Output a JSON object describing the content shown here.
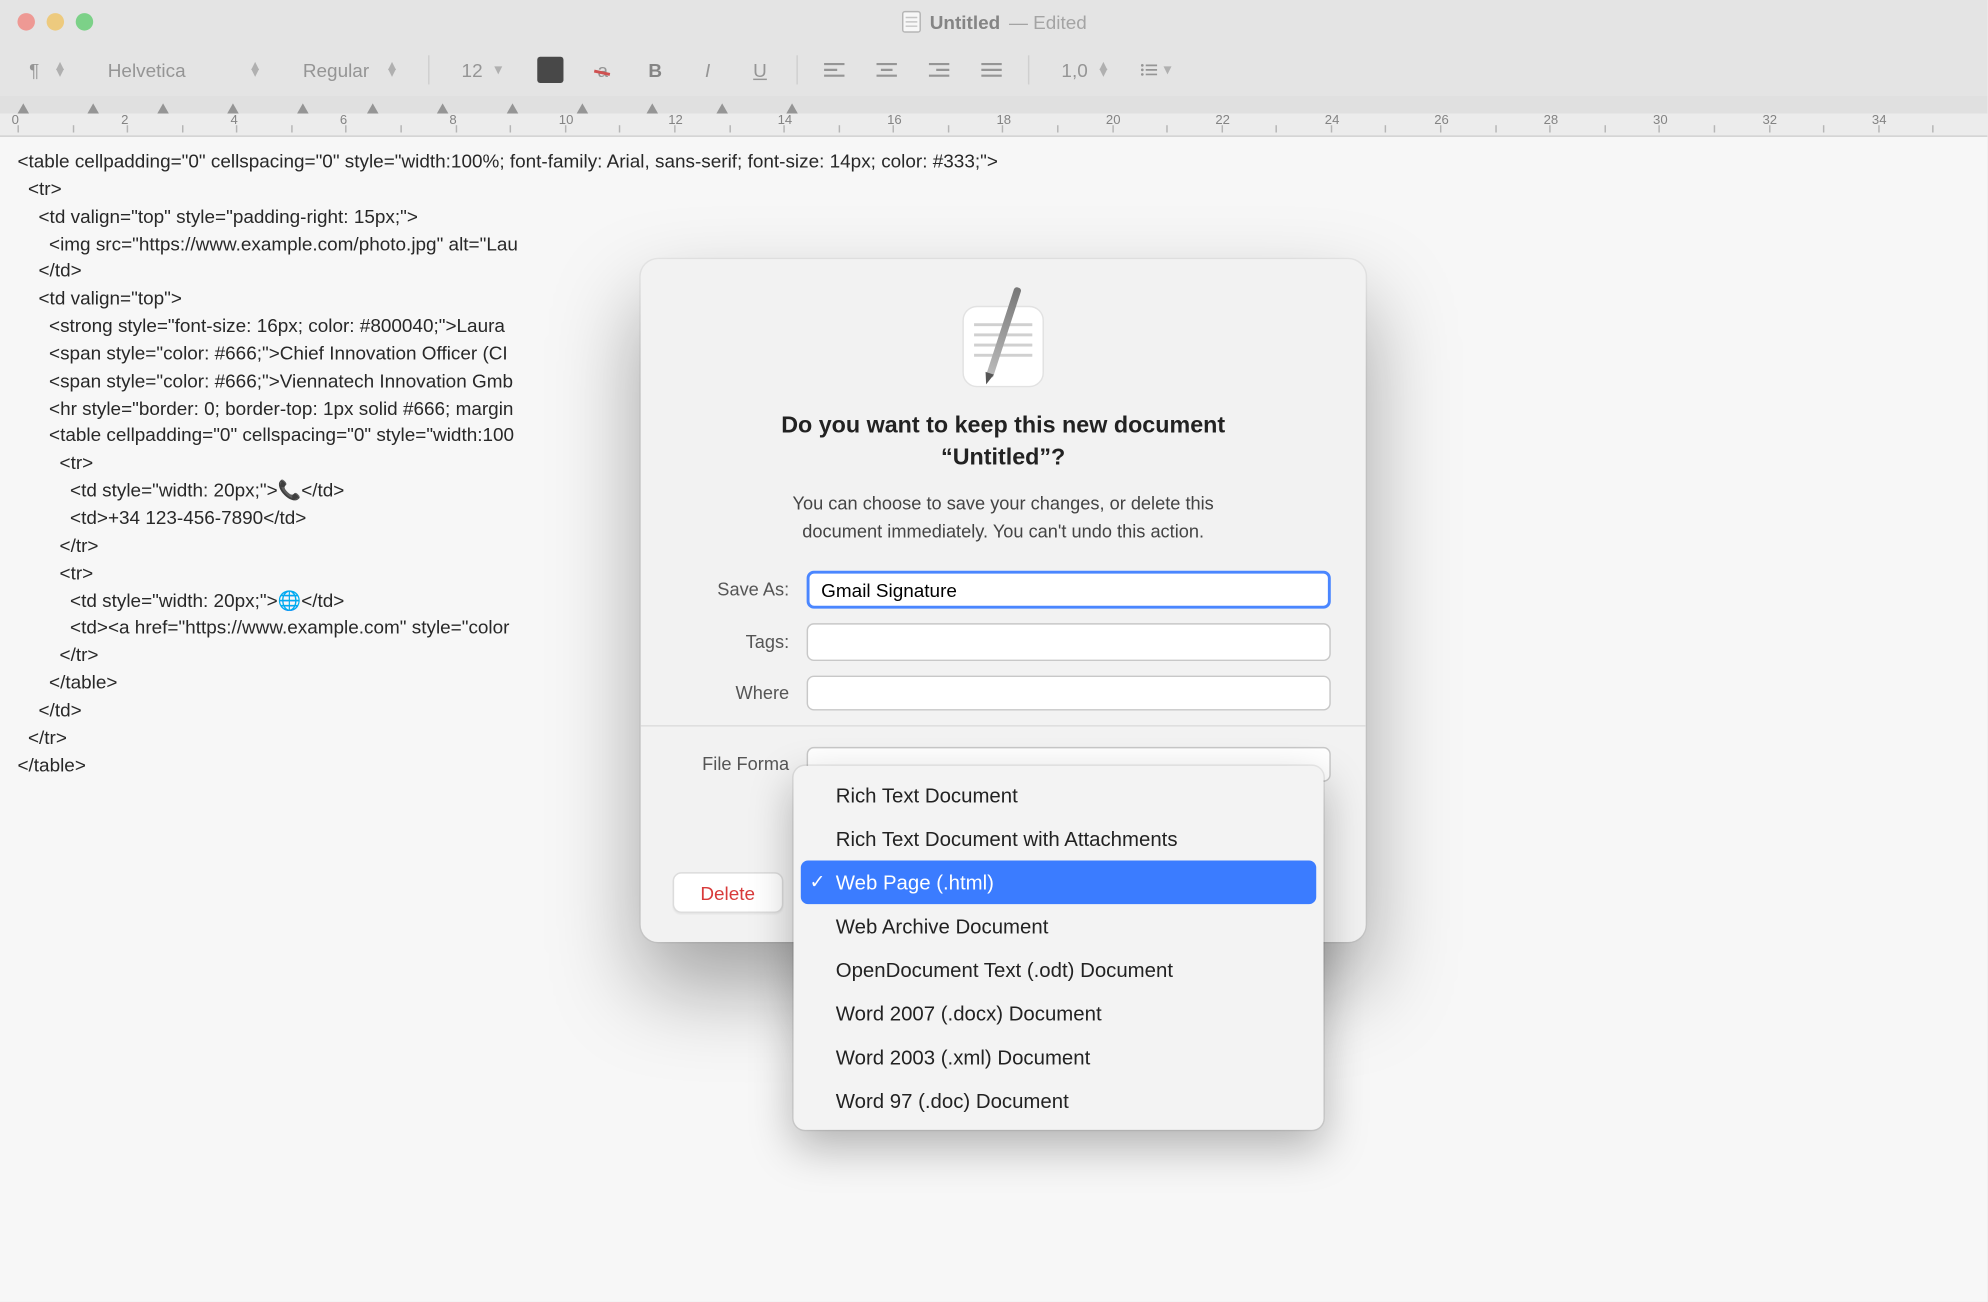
{
  "window": {
    "title": "Untitled",
    "status": "— Edited"
  },
  "toolbar": {
    "paragraph_symbol": "¶",
    "font_family": "Helvetica",
    "font_style": "Regular",
    "font_size": "12",
    "line_spacing": "1,0"
  },
  "ruler": {
    "marks": [
      "0",
      "2",
      "4",
      "6",
      "8",
      "10",
      "12",
      "14",
      "16",
      "18",
      "20",
      "22",
      "24",
      "26",
      "28",
      "30",
      "32",
      "34"
    ]
  },
  "document_lines": [
    "<table cellpadding=\"0\" cellspacing=\"0\" style=\"width:100%; font-family: Arial, sans-serif; font-size: 14px; color: #333;\">",
    "  <tr>",
    "    <td valign=\"top\" style=\"padding-right: 15px;\">",
    "      <img src=\"https://www.example.com/photo.jpg\" alt=\"Lau",
    "    </td>",
    "    <td valign=\"top\">",
    "      <strong style=\"font-size: 16px; color: #800040;\">Laura ",
    "      <span style=\"color: #666;\">Chief Innovation Officer (CI",
    "      <span style=\"color: #666;\">Viennatech Innovation Gmb",
    "      <hr style=\"border: 0; border-top: 1px solid #666; margin",
    "      <table cellpadding=\"0\" cellspacing=\"0\" style=\"width:100",
    "        <tr>",
    "          <td style=\"width: 20px;\">📞</td>",
    "          <td>+34 123-456-7890</td>",
    "        </tr>",
    "        <tr>",
    "          <td style=\"width: 20px;\">🌐</td>",
    "          <td><a href=\"https://www.example.com\" style=\"color",
    "        </tr>",
    "      </table>",
    "    </td>",
    "  </tr>",
    "</table>"
  ],
  "modal": {
    "heading_line1": "Do you want to keep this new document",
    "heading_line2": "“Untitled”?",
    "subtitle_line1": "You can choose to save your changes, or delete this",
    "subtitle_line2": "document immediately. You can't undo this action.",
    "save_as_label": "Save As:",
    "save_as_value": "Gmail Signature",
    "tags_label": "Tags:",
    "tags_value": "",
    "where_label": "Where",
    "file_format_label": "File Forma",
    "delete_button": "Delete"
  },
  "dropdown": {
    "items": [
      "Rich Text Document",
      "Rich Text Document with Attachments",
      "Web Page (.html)",
      "Web Archive Document",
      "OpenDocument Text (.odt) Document",
      "Word 2007 (.docx) Document",
      "Word 2003 (.xml) Document",
      "Word 97 (.doc) Document"
    ],
    "selected_index": 2
  }
}
